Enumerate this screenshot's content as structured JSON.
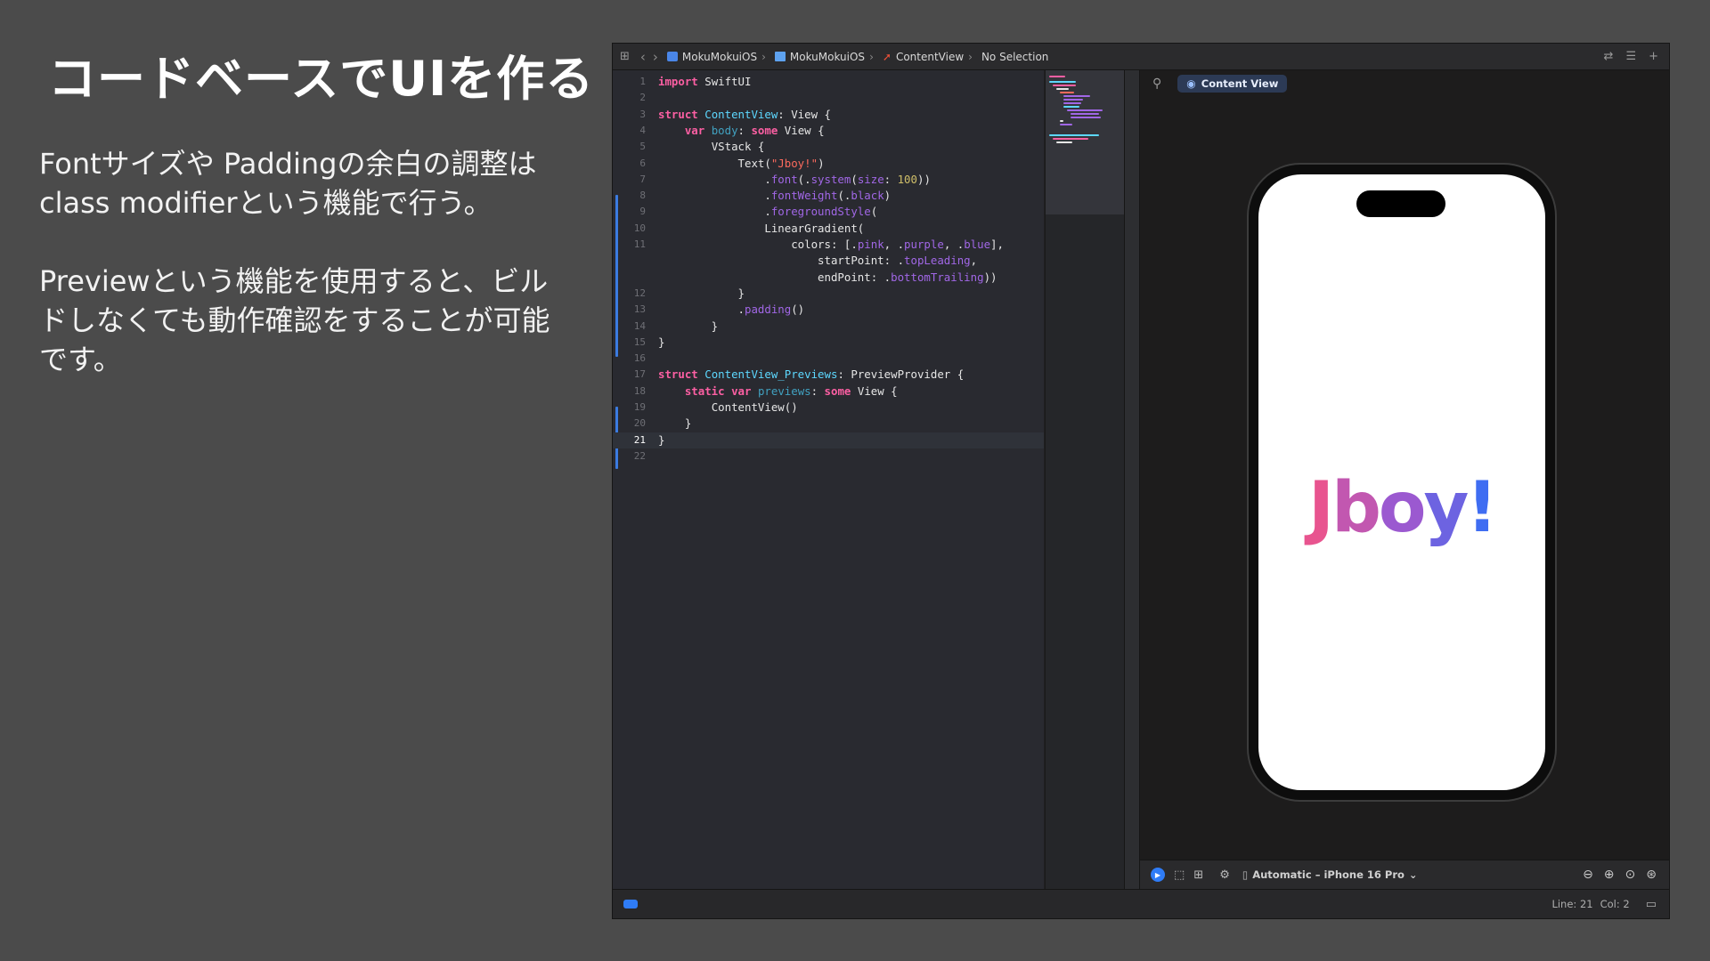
{
  "slide": {
    "title": "コードベースでUIを作る",
    "paragraph1": "Fontサイズや Paddingの余白の調整は class modifierという機能で行う。",
    "paragraph2": "Previewという機能を使用すると、ビルドしなくても動作確認をすることが可能です。"
  },
  "xcode": {
    "breadcrumbs": [
      "MokuMokuiOS",
      "MokuMokuiOS",
      "ContentView",
      "No Selection"
    ],
    "preview_label": "Content View",
    "device_selector": "Automatic – iPhone 16 Pro",
    "status": {
      "line": "Line: 21",
      "col": "Col: 2"
    },
    "preview_text": "Jboy!",
    "gradient_colors": [
      "#e8548f",
      "#9b59d0",
      "#3f6df2"
    ],
    "accent_color": "#2f7cf6",
    "code_lines": [
      {
        "n": "1",
        "t": "import SwiftUI"
      },
      {
        "n": "2",
        "t": ""
      },
      {
        "n": "3",
        "t": "struct ContentView: View {"
      },
      {
        "n": "4",
        "t": "    var body: some View {"
      },
      {
        "n": "5",
        "t": "        VStack {"
      },
      {
        "n": "6",
        "t": "            Text(\"Jboy!\")"
      },
      {
        "n": "7",
        "t": "                .font(.system(size: 100))"
      },
      {
        "n": "8",
        "t": "                .fontWeight(.black)"
      },
      {
        "n": "9",
        "t": "                .foregroundStyle("
      },
      {
        "n": "10",
        "t": "                LinearGradient("
      },
      {
        "n": "11",
        "t": "                    colors: [.pink, .purple, .blue],"
      },
      {
        "n": "",
        "t": "                        startPoint: .topLeading,"
      },
      {
        "n": "",
        "t": "                        endPoint: .bottomTrailing))"
      },
      {
        "n": "12",
        "t": "            }"
      },
      {
        "n": "13",
        "t": "            .padding()"
      },
      {
        "n": "14",
        "t": "        }"
      },
      {
        "n": "15",
        "t": "}"
      },
      {
        "n": "16",
        "t": ""
      },
      {
        "n": "17",
        "t": "struct ContentView_Previews: PreviewProvider {"
      },
      {
        "n": "18",
        "t": "    static var previews: some View {"
      },
      {
        "n": "19",
        "t": "        ContentView()"
      },
      {
        "n": "20",
        "t": "    }"
      },
      {
        "n": "21",
        "t": "}"
      },
      {
        "n": "22",
        "t": ""
      }
    ]
  }
}
